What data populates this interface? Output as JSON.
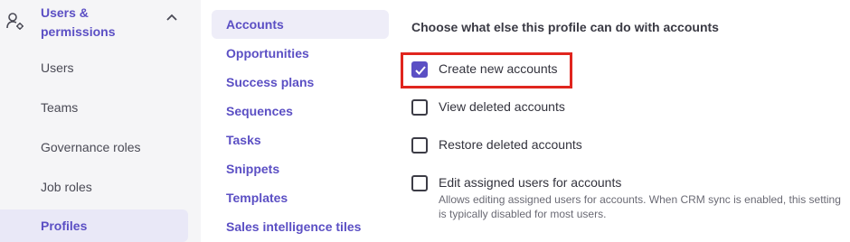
{
  "sidebar": {
    "section_title": "Users & permissions",
    "items": [
      {
        "label": "Users"
      },
      {
        "label": "Teams"
      },
      {
        "label": "Governance roles"
      },
      {
        "label": "Job roles"
      },
      {
        "label": "Profiles"
      }
    ]
  },
  "objects": {
    "items": [
      {
        "label": "Accounts"
      },
      {
        "label": "Opportunities"
      },
      {
        "label": "Success plans"
      },
      {
        "label": "Sequences"
      },
      {
        "label": "Tasks"
      },
      {
        "label": "Snippets"
      },
      {
        "label": "Templates"
      },
      {
        "label": "Sales intelligence tiles"
      }
    ]
  },
  "permissions": {
    "heading": "Choose what else this profile can do with accounts",
    "items": [
      {
        "label": "Create new accounts",
        "checked": true
      },
      {
        "label": "View deleted accounts",
        "checked": false
      },
      {
        "label": "Restore deleted accounts",
        "checked": false
      },
      {
        "label": "Edit assigned users for accounts",
        "checked": false,
        "description": "Allows editing assigned users for accounts. When CRM sync is enabled, this setting is typically disabled for most users."
      }
    ]
  },
  "colors": {
    "accent": "#5b4fc4",
    "highlight": "#e0251e",
    "sidebar_bg": "#f5f5f7"
  }
}
